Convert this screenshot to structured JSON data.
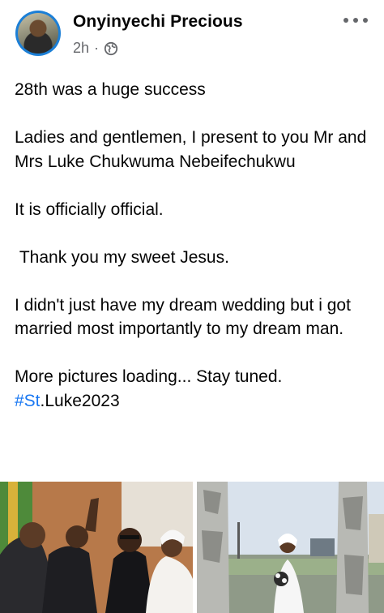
{
  "post": {
    "author": "Onyinyechi Precious",
    "time": "2h",
    "separator": "·",
    "privacy_icon": "globe-icon",
    "more_icon": "more-options-icon",
    "paragraphs": [
      "28th was a huge success",
      "Ladies and gentlemen, I present to you Mr and Mrs Luke Chukwuma Nebeifechukwu",
      "It is officially official.",
      " Thank you my sweet Jesus.",
      "I didn't just have my dream wedding but i got married most importantly to my dream man."
    ],
    "closing_line": "More pictures loading... Stay tuned.",
    "hashtag": {
      "hash": "#St",
      "rest": ".Luke2023"
    }
  },
  "photos": [
    {
      "name": "wedding-photo-couple-raising-hands"
    },
    {
      "name": "wedding-photo-bride-outdoor"
    }
  ],
  "colors": {
    "text": "#050505",
    "secondary": "#65676b",
    "link": "#1877f2",
    "avatar_ring": "#1c7fd6"
  }
}
